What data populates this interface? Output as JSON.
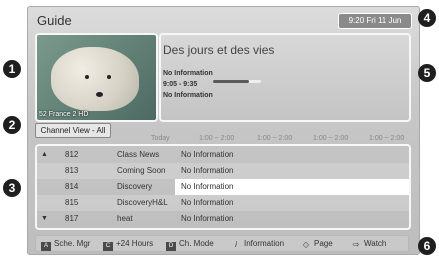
{
  "title": "Guide",
  "datetime": "9:20 Fri 11 Jun",
  "preview": {
    "channel_label": "52 France 2 HD"
  },
  "program_info": {
    "title": "Des jours et des vies",
    "line1": "No Information",
    "time": "9:05 - 9:35",
    "line3": "No Information",
    "progress": 0.75
  },
  "view_label": "Channel View - All",
  "time_header": {
    "day": "Today",
    "slots": [
      "1:00 ~ 2:00",
      "1:00 ~ 2:00",
      "1:00 ~ 2:00",
      "1:00 ~ 2:00"
    ]
  },
  "channels": [
    {
      "arrow": "▲",
      "number": "812",
      "name": "Class News",
      "program": "No Information"
    },
    {
      "arrow": "",
      "number": "813",
      "name": "Coming Soon",
      "program": "No Information"
    },
    {
      "arrow": "",
      "number": "814",
      "name": "Discovery",
      "program": "No Information",
      "selected": true
    },
    {
      "arrow": "",
      "number": "815",
      "name": "DiscoveryH&L",
      "program": "No Information"
    },
    {
      "arrow": "▼",
      "number": "817",
      "name": "heat",
      "program": "No Information"
    }
  ],
  "footer": [
    {
      "key": "A",
      "label": "Sche. Mgr"
    },
    {
      "key": "C",
      "label": "+24 Hours"
    },
    {
      "key": "D",
      "label": "Ch. Mode"
    },
    {
      "key": "i",
      "label": "Information"
    },
    {
      "key": "◇",
      "label": "Page"
    },
    {
      "key": "⇨",
      "label": "Watch"
    }
  ],
  "callouts": [
    "1",
    "2",
    "3",
    "4",
    "5",
    "6"
  ]
}
